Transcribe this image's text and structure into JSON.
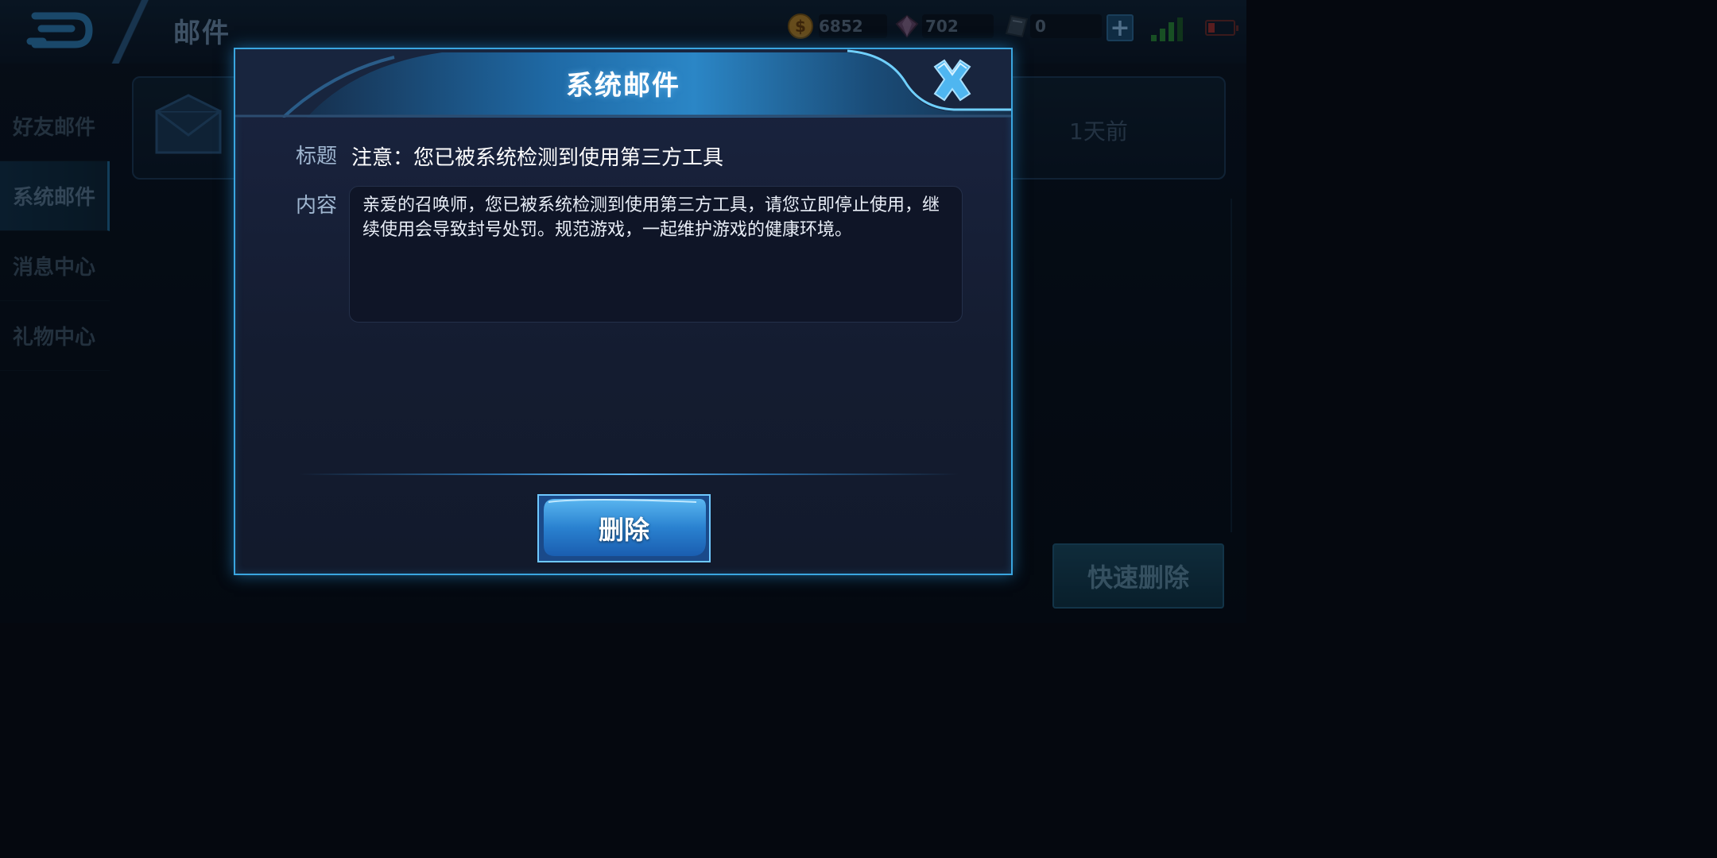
{
  "header": {
    "title": "邮件",
    "currencies": [
      {
        "icon": "gold-coin-icon",
        "value": "6852"
      },
      {
        "icon": "diamond-icon",
        "value": "702"
      },
      {
        "icon": "voucher-icon",
        "value": "0"
      }
    ],
    "plus_label": "+"
  },
  "sidebar": {
    "items": [
      {
        "label": "好友邮件",
        "active": false
      },
      {
        "label": "系统邮件",
        "active": true
      },
      {
        "label": "消息中心",
        "active": false
      },
      {
        "label": "礼物中心",
        "active": false
      }
    ]
  },
  "mail_list": {
    "items": [
      {
        "time": "1天前"
      }
    ]
  },
  "quick_delete_label": "快速删除",
  "dialog": {
    "title": "系统邮件",
    "subject_label": "标题",
    "subject": "注意：您已被系统检测到使用第三方工具",
    "content_label": "内容",
    "content": "亲爱的召唤师，您已被系统检测到使用第三方工具，请您立即停止使用，继续使用会导致封号处罚。规范游戏，一起维护游戏的健康环境。",
    "delete_label": "删除"
  },
  "colors": {
    "accent": "#3aa6e0",
    "dialog_bg": "#1a2440",
    "button_blue": "#2a7fd0"
  }
}
